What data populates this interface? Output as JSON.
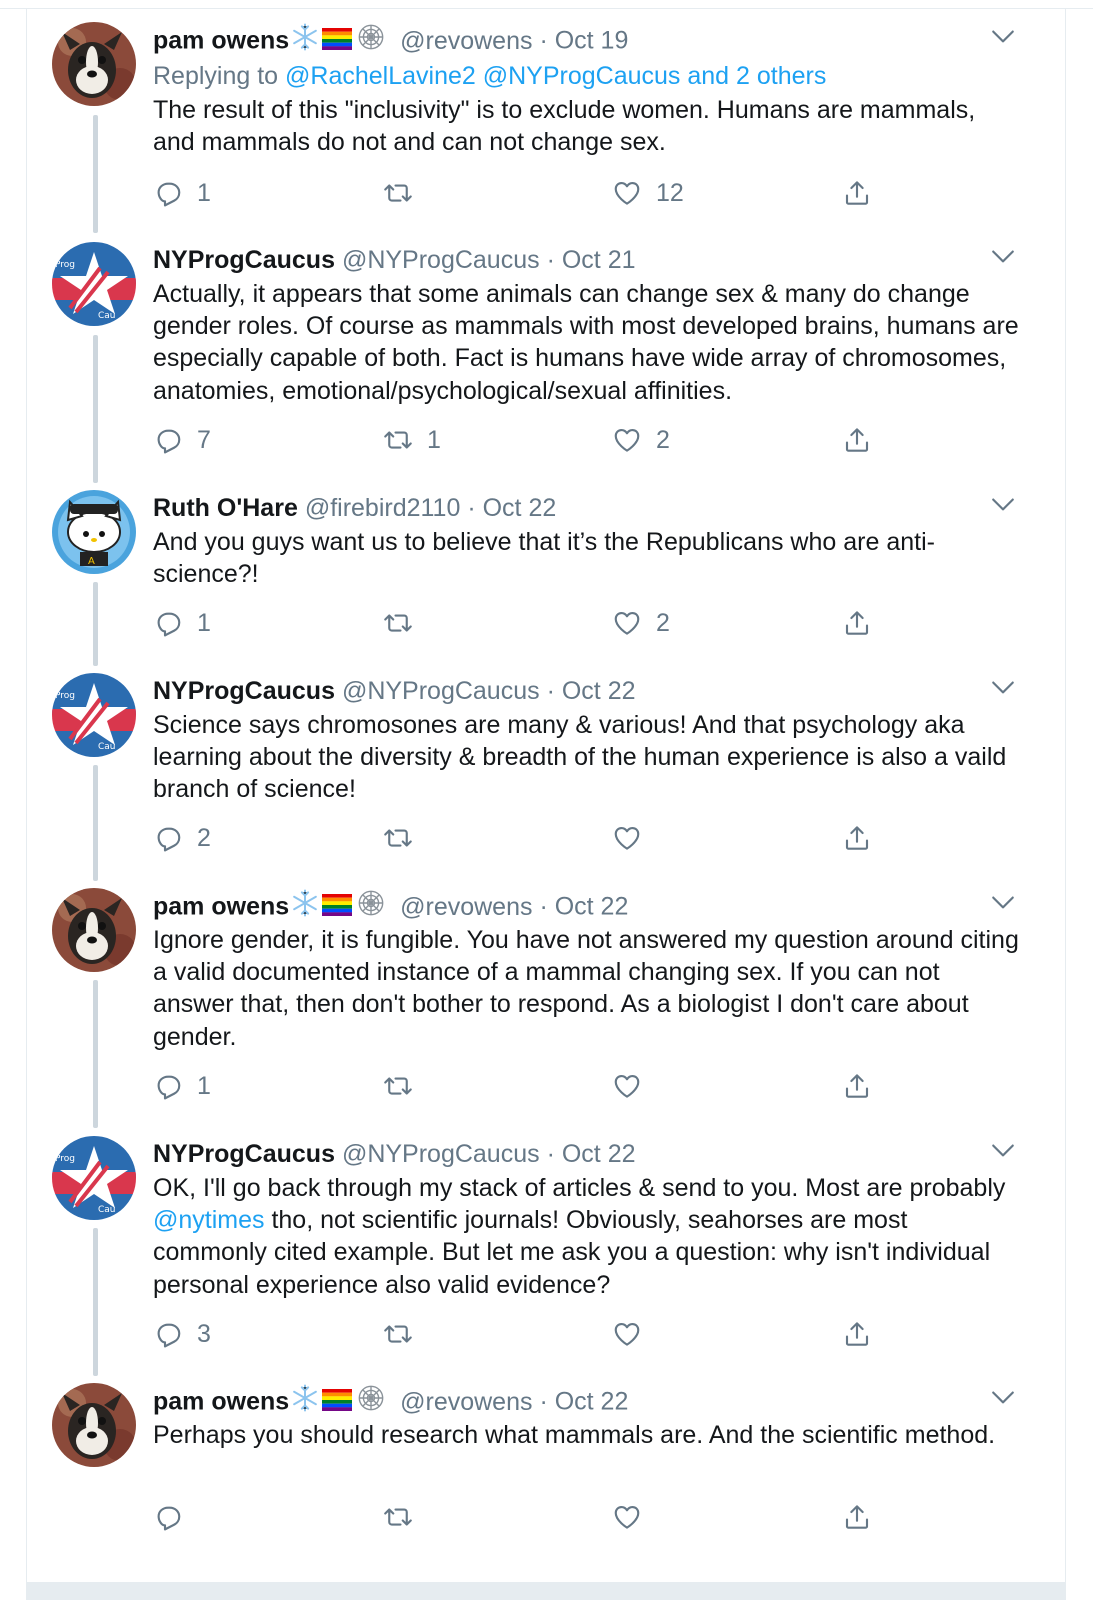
{
  "tweets": [
    {
      "name": "pam owens",
      "handle": "@revowens",
      "date": "Oct 19",
      "avatar": "dog-avatar",
      "badges": [
        "snowflake-icon",
        "rainbow-flag-icon",
        "spiderweb-icon"
      ],
      "reply_prefix": "Replying to ",
      "reply_targets": "@RachelLavine2 @NYProgCaucus and 2 others",
      "text": "The result of this \"inclusivity\" is to exclude women. Humans are mammals, and mammals do not and can not change sex.",
      "replies": "1",
      "retweets": "",
      "likes": "12"
    },
    {
      "name": "NYProgCaucus",
      "handle": "@NYProgCaucus",
      "date": "Oct 21",
      "avatar": "caucus-star-logo",
      "text": "Actually, it appears that some animals can change sex & many do change gender roles. Of course as mammals with most developed brains, humans are especially capable of both. Fact is humans have wide array of chromosomes, anatomies, emotional/psychological/sexual affinities.",
      "replies": "7",
      "retweets": "1",
      "likes": "2"
    },
    {
      "name": "Ruth O'Hare",
      "handle": "@firebird2110",
      "date": "Oct 22",
      "avatar": "cat-avatar",
      "text": "And you guys want us to believe that it’s the Republicans who are anti-science?!",
      "replies": "1",
      "retweets": "",
      "likes": "2"
    },
    {
      "name": "NYProgCaucus",
      "handle": "@NYProgCaucus",
      "date": "Oct 22",
      "avatar": "caucus-star-logo",
      "text": "Science says chromosones are many & various! And that psychology aka learning about the diversity & breadth of the human experience is also a vaild branch of science!",
      "replies": "2",
      "retweets": "",
      "likes": ""
    },
    {
      "name": "pam owens",
      "handle": "@revowens",
      "date": "Oct 22",
      "avatar": "dog-avatar",
      "badges": [
        "snowflake-icon",
        "rainbow-flag-icon",
        "spiderweb-icon"
      ],
      "text": "Ignore gender, it is fungible. You have not answered my question around citing a valid documented instance of a mammal changing sex. If you can not answer that, then don't bother to respond. As a biologist I don't care about gender.",
      "replies": "1",
      "retweets": "",
      "likes": ""
    },
    {
      "name": "NYProgCaucus",
      "handle": "@NYProgCaucus",
      "date": "Oct 22",
      "avatar": "caucus-star-logo",
      "text_before": "OK, I'll go back through my stack of articles & send to you. Most are probably ",
      "mention": "@nytimes",
      "text_after": " tho, not scientific journals! Obviously, seahorses are most commonly cited example. But let me ask you a question: why isn't individual personal experience also valid evidence?",
      "replies": "3",
      "retweets": "",
      "likes": ""
    },
    {
      "name": "pam owens",
      "handle": "@revowens",
      "date": "Oct 22",
      "avatar": "dog-avatar",
      "badges": [
        "snowflake-icon",
        "rainbow-flag-icon",
        "spiderweb-icon"
      ],
      "text": "Perhaps you should research what mammals are. And the scientific method.",
      "replies": "",
      "retweets": "",
      "likes": ""
    }
  ],
  "colors": {
    "link": "#1da1f2",
    "muted": "#657786",
    "thread": "#cdd6dd"
  }
}
